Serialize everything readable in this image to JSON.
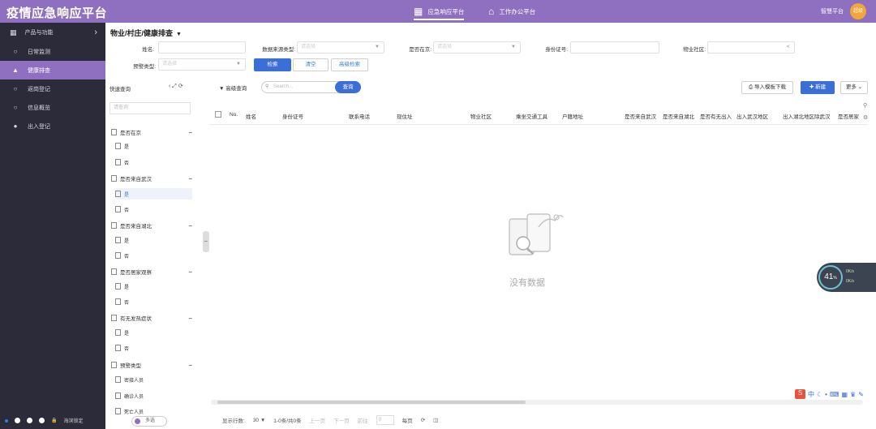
{
  "header": {
    "app_title": "疫情应急响应平台",
    "nav_primary": "应急响应平台",
    "nav_secondary": "工作办公平台",
    "user_name": "智慧平台",
    "avatar_text": "超级"
  },
  "sidebar": {
    "title": "产品与功能",
    "items": [
      {
        "label": "日常监测",
        "icon": "circle-icon"
      },
      {
        "label": "健康排查",
        "icon": "warning-icon"
      },
      {
        "label": "返岗登记",
        "icon": "circle-icon"
      },
      {
        "label": "信息概览",
        "icon": "circle-icon"
      },
      {
        "label": "出入登记",
        "icon": "chat-icon"
      }
    ],
    "active_index": 1,
    "bottom_label": "海滨锁定"
  },
  "breadcrumb": "物业/村庄/健康排查",
  "filters": {
    "name_label": "姓名:",
    "source_label": "数据来源类型:",
    "source_placeholder": "请选择",
    "inplace_label": "是否在京:",
    "inplace_placeholder": "请选择",
    "idcard_label": "身份证号:",
    "community_label": "物业社区:",
    "warn_label": "预警类型:",
    "warn_placeholder": "请选择",
    "search_btn": "检索",
    "clear_btn": "清空",
    "adv_btn": "高级检索"
  },
  "quick_query": {
    "title": "快速查询",
    "tools": "‹ ⤢ ⟳",
    "search_placeholder": "请查询",
    "groups": [
      {
        "label": "是否在京",
        "items": [
          "是",
          "否"
        ]
      },
      {
        "label": "是否来自武汉",
        "items": [
          "是",
          "否"
        ]
      },
      {
        "label": "是否来自湖北",
        "items": [
          "是",
          "否"
        ]
      },
      {
        "label": "是否居家观察",
        "items": [
          "是",
          "否"
        ]
      },
      {
        "label": "有无发热症状",
        "items": [
          "是",
          "否"
        ]
      },
      {
        "label": "预警类型",
        "items": [
          "密接人员",
          "确诊人员",
          "死亡人员"
        ]
      }
    ],
    "toggle_label": "多选"
  },
  "toolbar": {
    "adv_query": "高级查询",
    "search_placeholder": "Search...",
    "search_btn": "查询",
    "import_btn": "导入模板下载",
    "new_btn": "新建",
    "more_btn": "更多"
  },
  "table": {
    "columns": [
      "No.",
      "姓名",
      "身份证号",
      "联系电话",
      "现住址",
      "物业社区",
      "乘坐交通工具",
      "户籍地址",
      "是否来自武汉",
      "是否来自湖北",
      "是否有无出入",
      "出入武汉地区",
      "出入湖北地区除武汉",
      "是否居家"
    ],
    "empty_text": "没有数据"
  },
  "pager": {
    "page_size_label": "显示行数:",
    "page_size": "30",
    "range": "1-0条/共0条",
    "prev": "上一页",
    "next": "下一页",
    "goto": "前往",
    "goto_value": "0",
    "page_unit": "每页"
  },
  "widget": {
    "percent": "41",
    "unit": "%",
    "up": "0K/s",
    "down": "0K/s"
  },
  "ime": {
    "logo": "S",
    "mode": "中"
  },
  "colors": {
    "topbar": "#8f6fbf",
    "sidebar": "#2b2b3a",
    "primary": "#3a6fd8"
  }
}
